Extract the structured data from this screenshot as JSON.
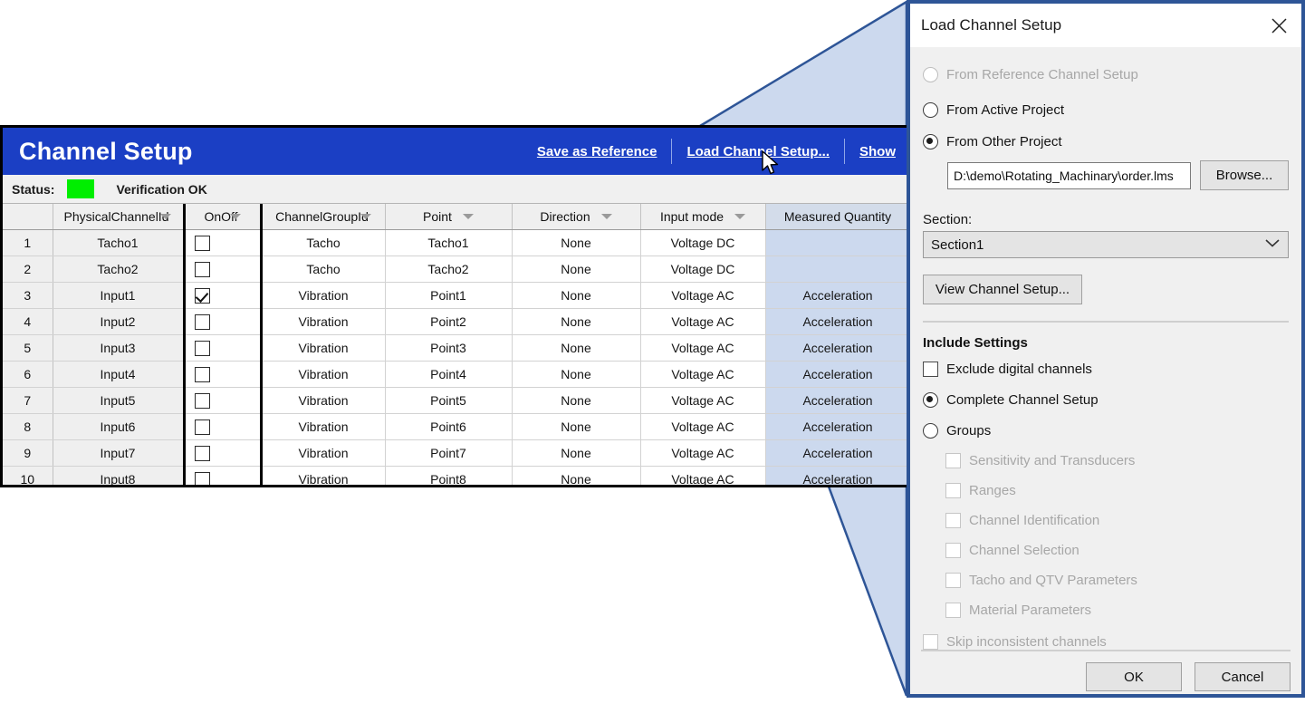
{
  "panel": {
    "title": "Channel Setup",
    "links": [
      {
        "label": "Save as Reference",
        "name": "save-as-reference-link"
      },
      {
        "label": "Load Channel Setup...",
        "name": "load-channel-setup-link"
      },
      {
        "label": "Show",
        "name": "show-link"
      }
    ],
    "status": {
      "label": "Status:",
      "text": "Verification OK",
      "color": "#00ee00"
    },
    "accent_color": "#1b3fc4"
  },
  "table": {
    "columns": [
      {
        "label": "",
        "filter": false
      },
      {
        "label": "PhysicalChannelId",
        "filter": true,
        "overlap": true
      },
      {
        "label": "OnOff",
        "filter": true,
        "overlap": true
      },
      {
        "label": "ChannelGroupId",
        "filter": true,
        "overlap": true
      },
      {
        "label": "Point",
        "filter": true,
        "overlap": false
      },
      {
        "label": "Direction",
        "filter": true,
        "overlap": false
      },
      {
        "label": "Input mode",
        "filter": true,
        "overlap": false
      },
      {
        "label": "Measured Quantity",
        "filter": false,
        "overlap": false
      }
    ],
    "rows": [
      {
        "num": "1",
        "physical_channel_id": "Tacho1",
        "onoff": false,
        "channel_group_id": "Tacho",
        "point": "Tacho1",
        "direction": "None",
        "input_mode": "Voltage DC",
        "measured_quantity": ""
      },
      {
        "num": "2",
        "physical_channel_id": "Tacho2",
        "onoff": false,
        "channel_group_id": "Tacho",
        "point": "Tacho2",
        "direction": "None",
        "input_mode": "Voltage DC",
        "measured_quantity": ""
      },
      {
        "num": "3",
        "physical_channel_id": "Input1",
        "onoff": true,
        "channel_group_id": "Vibration",
        "point": "Point1",
        "direction": "None",
        "input_mode": "Voltage AC",
        "measured_quantity": "Acceleration"
      },
      {
        "num": "4",
        "physical_channel_id": "Input2",
        "onoff": false,
        "channel_group_id": "Vibration",
        "point": "Point2",
        "direction": "None",
        "input_mode": "Voltage AC",
        "measured_quantity": "Acceleration"
      },
      {
        "num": "5",
        "physical_channel_id": "Input3",
        "onoff": false,
        "channel_group_id": "Vibration",
        "point": "Point3",
        "direction": "None",
        "input_mode": "Voltage AC",
        "measured_quantity": "Acceleration"
      },
      {
        "num": "6",
        "physical_channel_id": "Input4",
        "onoff": false,
        "channel_group_id": "Vibration",
        "point": "Point4",
        "direction": "None",
        "input_mode": "Voltage AC",
        "measured_quantity": "Acceleration"
      },
      {
        "num": "7",
        "physical_channel_id": "Input5",
        "onoff": false,
        "channel_group_id": "Vibration",
        "point": "Point5",
        "direction": "None",
        "input_mode": "Voltage AC",
        "measured_quantity": "Acceleration"
      },
      {
        "num": "8",
        "physical_channel_id": "Input6",
        "onoff": false,
        "channel_group_id": "Vibration",
        "point": "Point6",
        "direction": "None",
        "input_mode": "Voltage AC",
        "measured_quantity": "Acceleration"
      },
      {
        "num": "9",
        "physical_channel_id": "Input7",
        "onoff": false,
        "channel_group_id": "Vibration",
        "point": "Point7",
        "direction": "None",
        "input_mode": "Voltage AC",
        "measured_quantity": "Acceleration"
      },
      {
        "num": "10",
        "physical_channel_id": "Input8",
        "onoff": false,
        "channel_group_id": "Vibration",
        "point": "Point8",
        "direction": "None",
        "input_mode": "Voltage AC",
        "measured_quantity": "Acceleration"
      }
    ]
  },
  "dialog": {
    "title": "Load Channel Setup",
    "close_icon": "close-icon",
    "source_options": [
      {
        "label": "From Reference Channel Setup",
        "selected": false,
        "disabled": true
      },
      {
        "label": "From Active Project",
        "selected": false,
        "disabled": false
      },
      {
        "label": "From Other Project",
        "selected": true,
        "disabled": false
      }
    ],
    "path": {
      "value": "D:\\demo\\Rotating_Machinary\\order.lms",
      "placeholder": "Project path"
    },
    "browse_label": "Browse...",
    "section": {
      "label": "Section:",
      "value": "Section1"
    },
    "view_channel_setup_label": "View Channel Setup...",
    "include_settings_title": "Include Settings",
    "exclude_digital": {
      "label": "Exclude digital channels",
      "checked": false,
      "disabled": false
    },
    "mode_options": [
      {
        "label": "Complete Channel Setup",
        "selected": true,
        "disabled": false
      },
      {
        "label": "Groups",
        "selected": false,
        "disabled": false
      }
    ],
    "group_items": [
      {
        "label": "Sensitivity and Transducers",
        "checked": false,
        "disabled": true
      },
      {
        "label": "Ranges",
        "checked": false,
        "disabled": true
      },
      {
        "label": "Channel Identification",
        "checked": false,
        "disabled": true
      },
      {
        "label": "Channel Selection",
        "checked": false,
        "disabled": true
      },
      {
        "label": "Tacho and QTV Parameters",
        "checked": false,
        "disabled": true
      },
      {
        "label": "Material Parameters",
        "checked": false,
        "disabled": true
      }
    ],
    "skip_inconsistent": {
      "label": "Skip inconsistent channels",
      "checked": false,
      "disabled": true
    },
    "ok_label": "OK",
    "cancel_label": "Cancel",
    "border_color": "#2e5597"
  },
  "callout": {
    "fill": "#ccd9ee",
    "stroke": "#2e5597"
  }
}
